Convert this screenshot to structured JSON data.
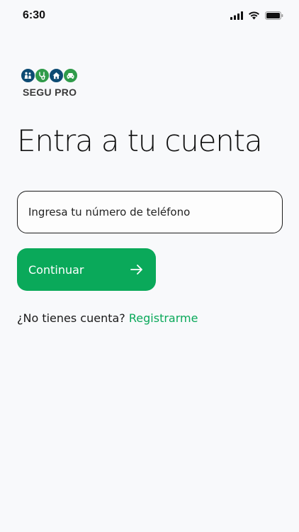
{
  "status_bar": {
    "time": "6:30",
    "icons": [
      "signal-icon",
      "wifi-icon",
      "battery-icon"
    ]
  },
  "logo": {
    "text": "SEGU PRO",
    "icons": [
      "family-icon",
      "stethoscope-icon",
      "home-icon",
      "car-icon"
    ],
    "colors": [
      "#0d4b73",
      "#2f9b4a",
      "#0d4b73",
      "#2f9b4a"
    ]
  },
  "login": {
    "title": "Entra a tu cuenta",
    "phone_placeholder": "Ingresa tu número de teléfono",
    "phone_value": "",
    "continue_label": "Continuar",
    "no_account_text": "¿No tienes cuenta?",
    "register_label": "Registrarme"
  },
  "colors": {
    "accent": "#0aa95a",
    "background": "#f8f9fb",
    "text": "#111111"
  }
}
